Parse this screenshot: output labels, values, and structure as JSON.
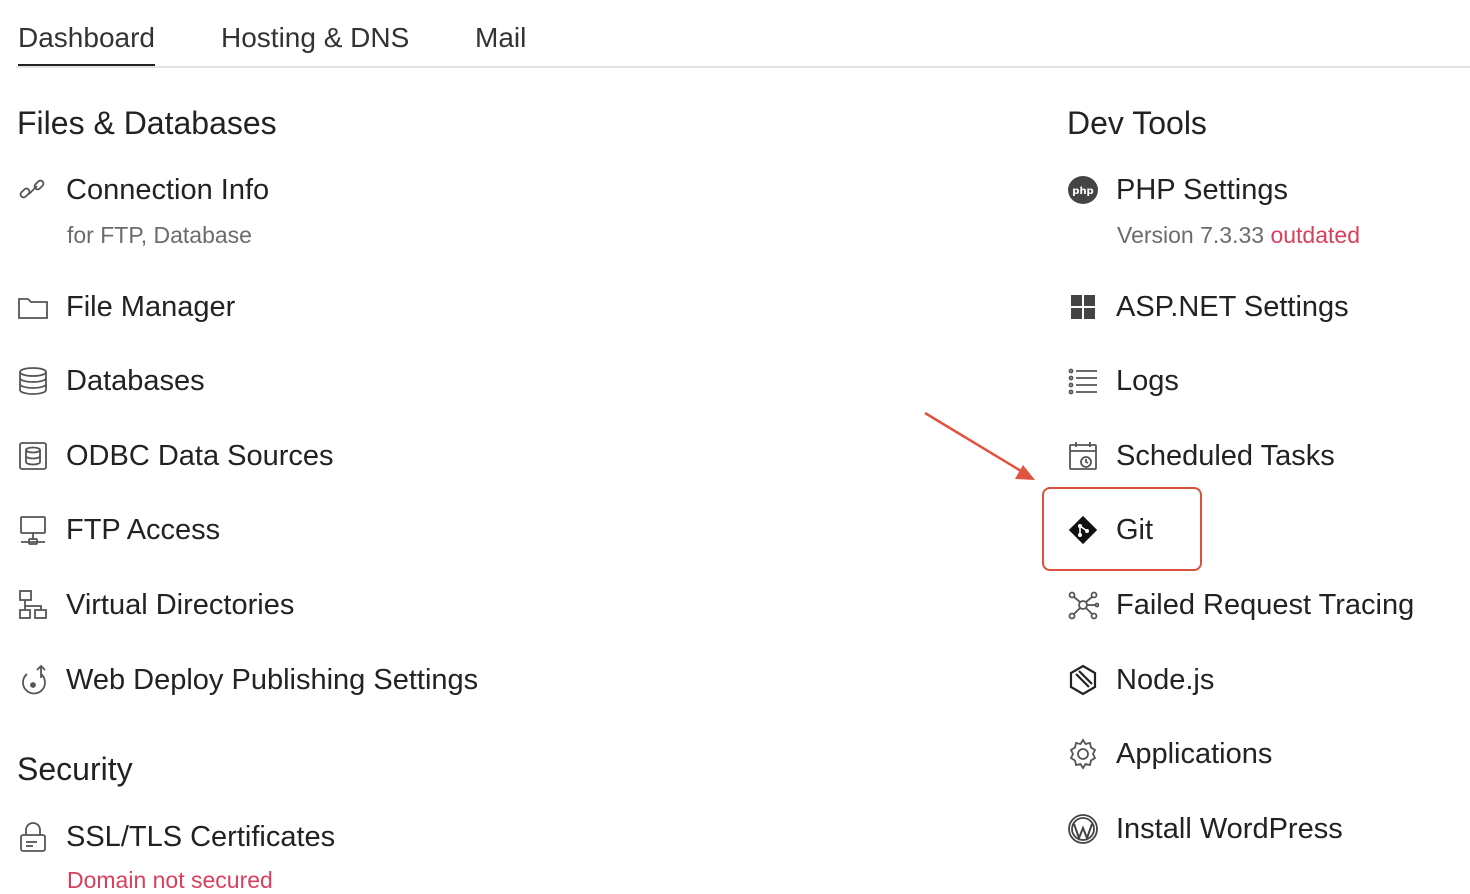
{
  "tabs": [
    {
      "label": "Dashboard",
      "active": true
    },
    {
      "label": "Hosting & DNS",
      "active": false
    },
    {
      "label": "Mail",
      "active": false
    }
  ],
  "left": {
    "files_heading": "Files & Databases",
    "items": [
      {
        "label": "Connection Info",
        "sub": "for FTP, Database",
        "icon": "link-icon"
      },
      {
        "label": "File Manager",
        "icon": "folder-icon"
      },
      {
        "label": "Databases",
        "icon": "database-icon"
      },
      {
        "label": "ODBC Data Sources",
        "icon": "odbc-icon"
      },
      {
        "label": "FTP Access",
        "icon": "ftp-icon"
      },
      {
        "label": "Virtual Directories",
        "icon": "directory-tree-icon"
      },
      {
        "label": "Web Deploy Publishing Settings",
        "icon": "web-deploy-icon"
      }
    ],
    "security_heading": "Security",
    "security_items": [
      {
        "label": "SSL/TLS Certificates",
        "sub": "Domain not secured",
        "icon": "certificate-icon"
      }
    ]
  },
  "right": {
    "heading": "Dev Tools",
    "items": [
      {
        "label": "PHP Settings",
        "sub": "Version 7.3.33",
        "sub_status": "outdated",
        "icon": "php-icon"
      },
      {
        "label": "ASP.NET Settings",
        "icon": "windows-icon"
      },
      {
        "label": "Logs",
        "icon": "list-icon"
      },
      {
        "label": "Scheduled Tasks",
        "icon": "calendar-clock-icon"
      },
      {
        "label": "Git",
        "icon": "git-icon",
        "highlighted": true
      },
      {
        "label": "Failed Request Tracing",
        "icon": "tracing-icon"
      },
      {
        "label": "Node.js",
        "icon": "nodejs-icon"
      },
      {
        "label": "Applications",
        "icon": "gear-icon"
      },
      {
        "label": "Install WordPress",
        "icon": "wordpress-icon"
      }
    ]
  },
  "colors": {
    "warning": "#d93f5d",
    "highlight": "#d9533c",
    "text": "#222222",
    "muted": "#6b6b6b"
  }
}
